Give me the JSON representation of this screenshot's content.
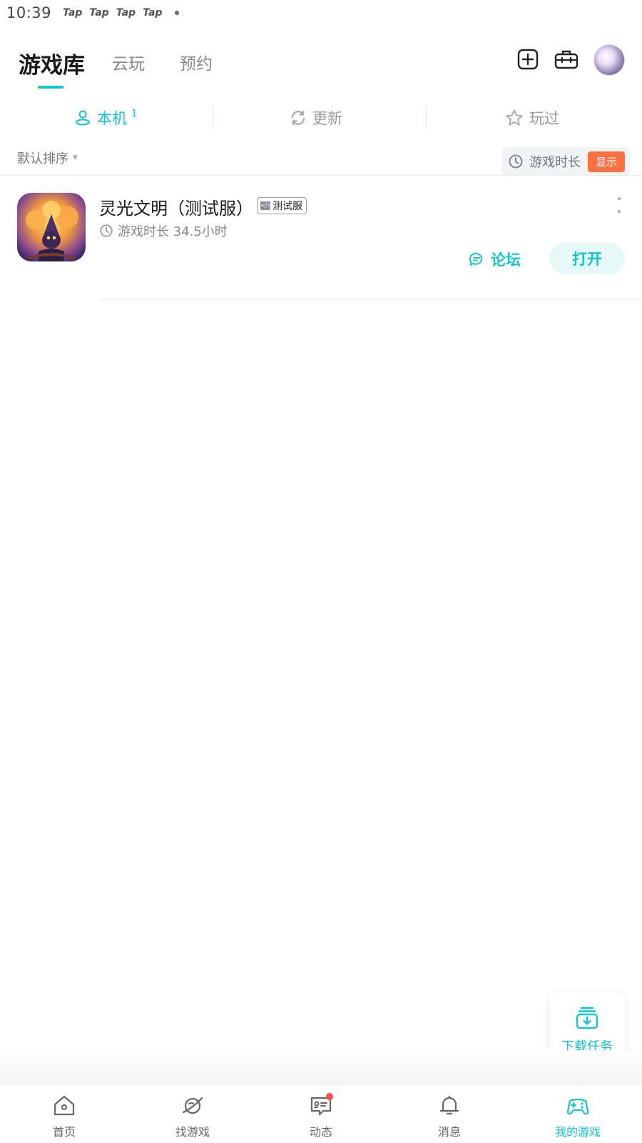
{
  "status_bar": {
    "time": "10:39",
    "notification_labels": [
      "Tap",
      "Tap",
      "Tap",
      "Tap"
    ]
  },
  "header": {
    "tabs": [
      {
        "label": "游戏库",
        "active": true
      },
      {
        "label": "云玩",
        "active": false
      },
      {
        "label": "预约",
        "active": false
      }
    ],
    "accent_color": "#15c5ce"
  },
  "subtabs": [
    {
      "label": "本机",
      "count": "1",
      "active": true,
      "icon": "user-pin-icon"
    },
    {
      "label": "更新",
      "count": "",
      "active": false,
      "icon": "refresh-icon"
    },
    {
      "label": "玩过",
      "count": "",
      "active": false,
      "icon": "star-icon"
    }
  ],
  "filters": {
    "sort_label": "默认排序",
    "playtime_label": "游戏时长",
    "show_label": "显示",
    "show_color": "#ff7043"
  },
  "games": [
    {
      "title": "灵光文明（测试服）",
      "badge": "测试服",
      "playtime": "游戏时长 34.5小时",
      "forum_label": "论坛",
      "open_label": "打开"
    }
  ],
  "download_task": {
    "label": "下载任务"
  },
  "bottom_nav": [
    {
      "label": "首页",
      "icon": "home-icon",
      "active": false
    },
    {
      "label": "找游戏",
      "icon": "planet-icon",
      "active": false
    },
    {
      "label": "动态",
      "icon": "chat-icon",
      "active": false,
      "has_dot": true
    },
    {
      "label": "消息",
      "icon": "bell-icon",
      "active": false
    },
    {
      "label": "我的游戏",
      "icon": "gamepad-icon",
      "active": true
    }
  ]
}
